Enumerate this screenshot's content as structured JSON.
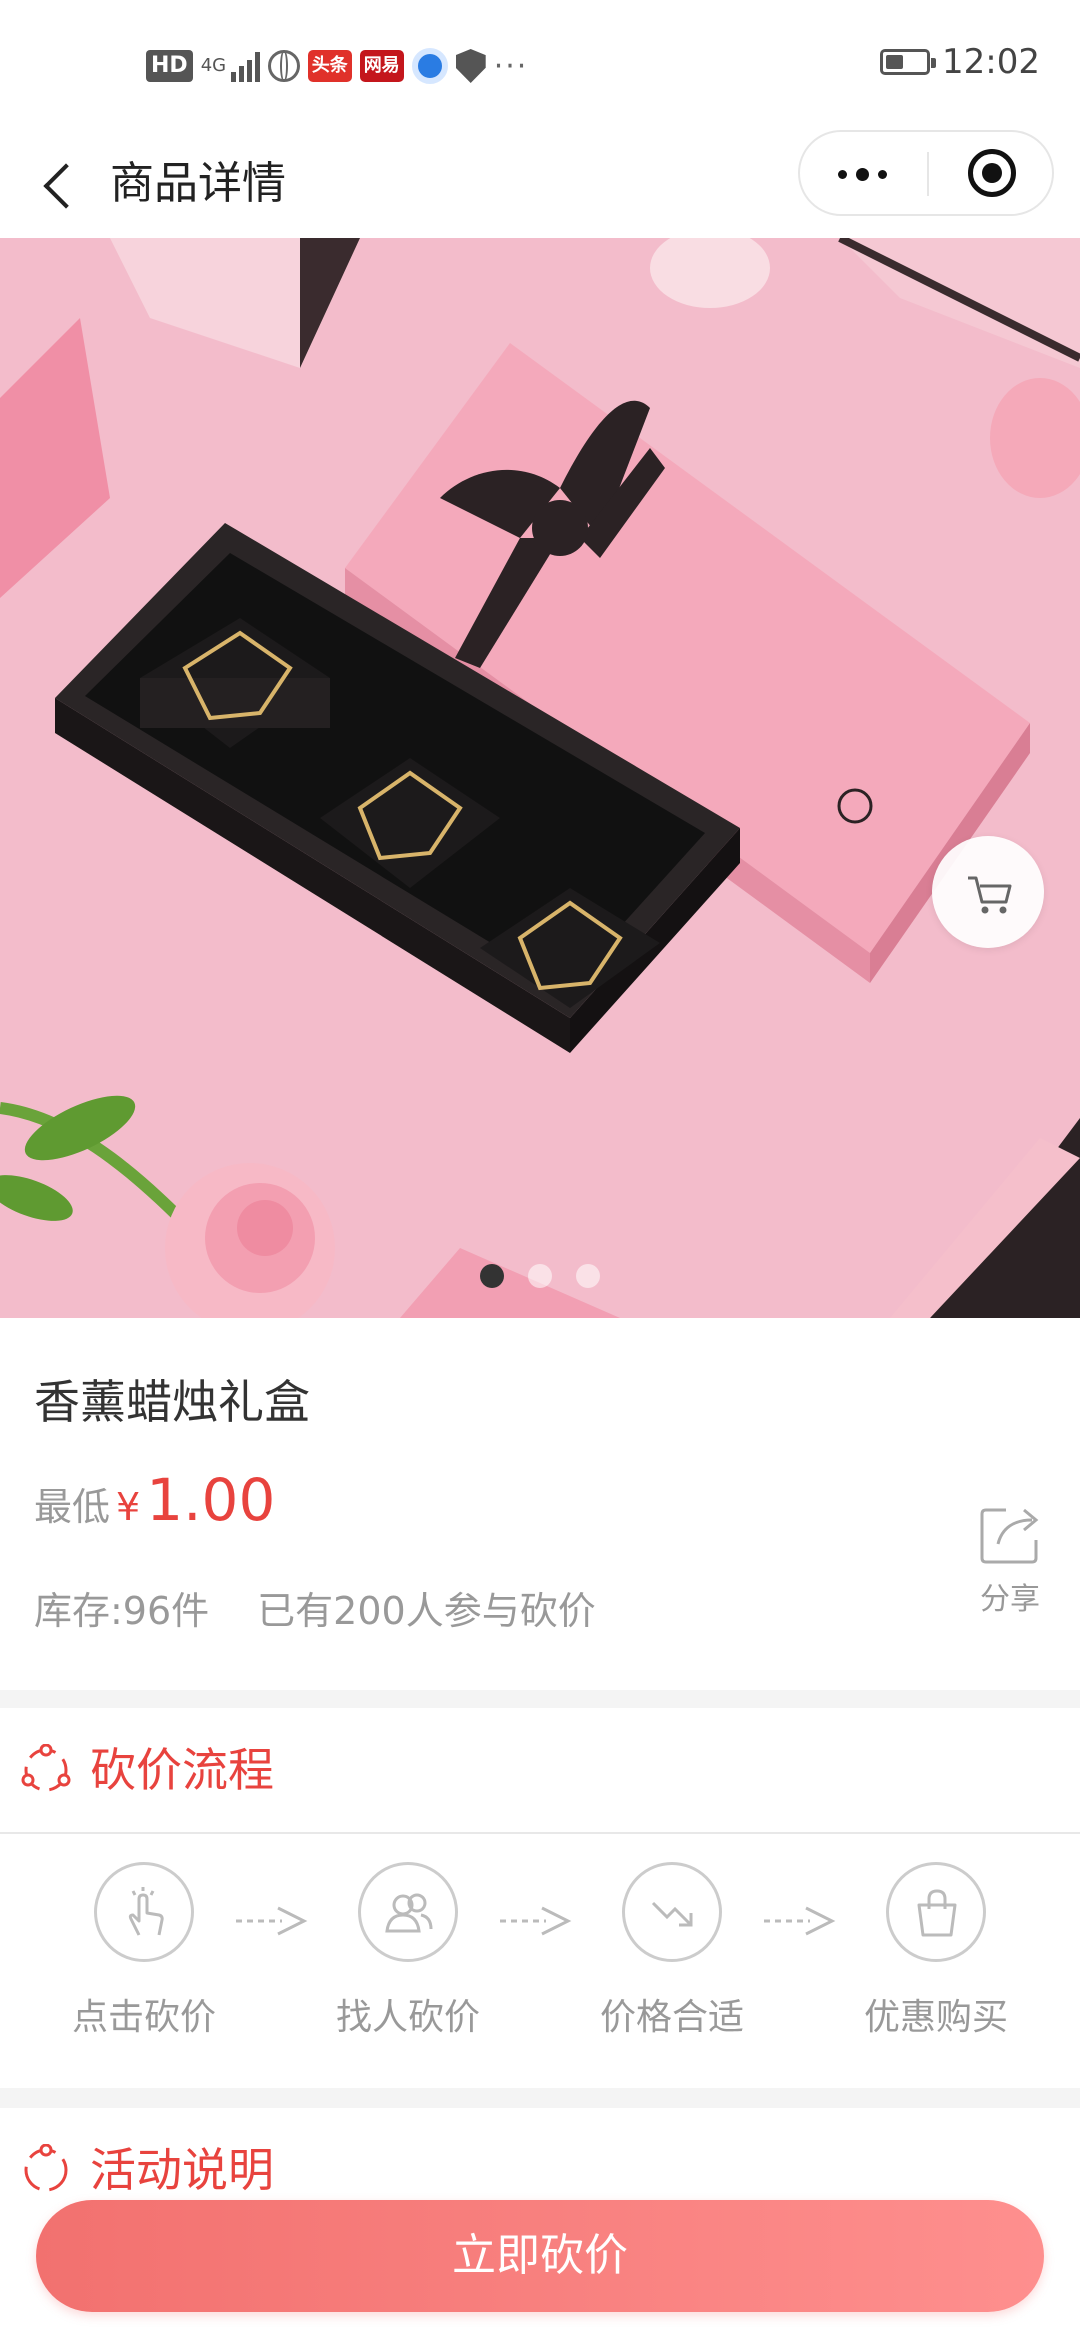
{
  "status_bar": {
    "hd": "HD",
    "network": "4G",
    "app_badges": [
      "头条",
      "网易"
    ],
    "time": "12:02",
    "battery_level": 0.45
  },
  "nav": {
    "title": "商品详情"
  },
  "banner": {
    "slide_count": 3,
    "active_slide": 1
  },
  "product": {
    "name": "香薰蜡烛礼盒",
    "price_label": "最低",
    "currency": "¥",
    "price": "1.00",
    "stock": "库存:96件",
    "participants": "已有200人参与砍价",
    "share_label": "分享"
  },
  "process": {
    "title": "砍价流程",
    "steps": [
      {
        "label": "点击砍价",
        "icon": "tap-icon"
      },
      {
        "label": "找人砍价",
        "icon": "people-icon"
      },
      {
        "label": "价格合适",
        "icon": "price-down-icon"
      },
      {
        "label": "优惠购买",
        "icon": "shopping-bag-icon"
      }
    ]
  },
  "activity": {
    "title": "活动说明"
  },
  "cta": {
    "label": "立即砍价"
  },
  "colors": {
    "accent": "#e8433e",
    "cta_start": "#f2716f",
    "cta_end": "#fe8f8e"
  }
}
